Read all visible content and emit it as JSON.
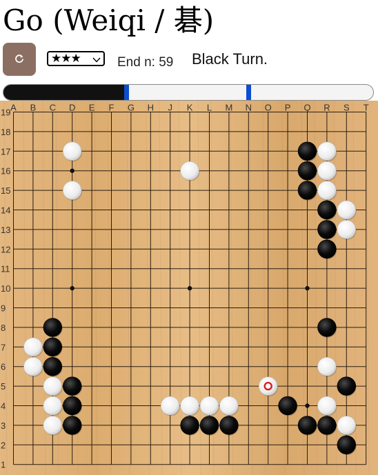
{
  "header": {
    "title": "Go (Weiqi / 碁)"
  },
  "toolbar": {
    "reload_icon": "reload-icon",
    "level": "★★★",
    "level_chevron_icon": "chevron-down-icon",
    "end_label": "End n:",
    "end_value": "59",
    "turn_status": "Black Turn."
  },
  "progress": {
    "fill_fraction": 0.333,
    "handle_positions": [
      0.333,
      0.662
    ]
  },
  "board": {
    "size": 19,
    "columns": [
      "A",
      "B",
      "C",
      "D",
      "E",
      "F",
      "G",
      "H",
      "J",
      "K",
      "L",
      "M",
      "N",
      "O",
      "P",
      "Q",
      "R",
      "S",
      "T"
    ],
    "rows": [
      "19",
      "18",
      "17",
      "16",
      "15",
      "14",
      "13",
      "12",
      "11",
      "10",
      "9",
      "8",
      "7",
      "6",
      "5",
      "4",
      "3",
      "2",
      "1"
    ],
    "hoshi": [
      "D16",
      "K16",
      "Q16",
      "D10",
      "K10",
      "Q10",
      "D4",
      "K4",
      "Q4"
    ],
    "stones": [
      {
        "color": "white",
        "point": "D17"
      },
      {
        "color": "white",
        "point": "D15"
      },
      {
        "color": "white",
        "point": "K16"
      },
      {
        "color": "black",
        "point": "Q17"
      },
      {
        "color": "white",
        "point": "R17"
      },
      {
        "color": "black",
        "point": "Q16"
      },
      {
        "color": "white",
        "point": "R16"
      },
      {
        "color": "black",
        "point": "Q15"
      },
      {
        "color": "white",
        "point": "R15"
      },
      {
        "color": "black",
        "point": "R14"
      },
      {
        "color": "white",
        "point": "S14"
      },
      {
        "color": "black",
        "point": "R13"
      },
      {
        "color": "white",
        "point": "S13"
      },
      {
        "color": "black",
        "point": "R12"
      },
      {
        "color": "black",
        "point": "C8"
      },
      {
        "color": "white",
        "point": "B7"
      },
      {
        "color": "black",
        "point": "C7"
      },
      {
        "color": "white",
        "point": "B6"
      },
      {
        "color": "black",
        "point": "C6"
      },
      {
        "color": "white",
        "point": "C5"
      },
      {
        "color": "black",
        "point": "D5"
      },
      {
        "color": "white",
        "point": "C4"
      },
      {
        "color": "black",
        "point": "D4"
      },
      {
        "color": "white",
        "point": "C3"
      },
      {
        "color": "black",
        "point": "D3"
      },
      {
        "color": "white",
        "point": "J4"
      },
      {
        "color": "white",
        "point": "K4"
      },
      {
        "color": "white",
        "point": "L4"
      },
      {
        "color": "white",
        "point": "M4"
      },
      {
        "color": "black",
        "point": "K3"
      },
      {
        "color": "black",
        "point": "L3"
      },
      {
        "color": "black",
        "point": "M3"
      },
      {
        "color": "white",
        "point": "O5"
      },
      {
        "color": "black",
        "point": "P4"
      },
      {
        "color": "black",
        "point": "Q3"
      },
      {
        "color": "black",
        "point": "R3"
      },
      {
        "color": "white",
        "point": "R4"
      },
      {
        "color": "white",
        "point": "S3"
      },
      {
        "color": "black",
        "point": "S2"
      },
      {
        "color": "black",
        "point": "R8"
      },
      {
        "color": "white",
        "point": "R6"
      },
      {
        "color": "black",
        "point": "S5"
      }
    ],
    "last_move": "O5",
    "last_move_marker_color": "#d81e1e"
  }
}
